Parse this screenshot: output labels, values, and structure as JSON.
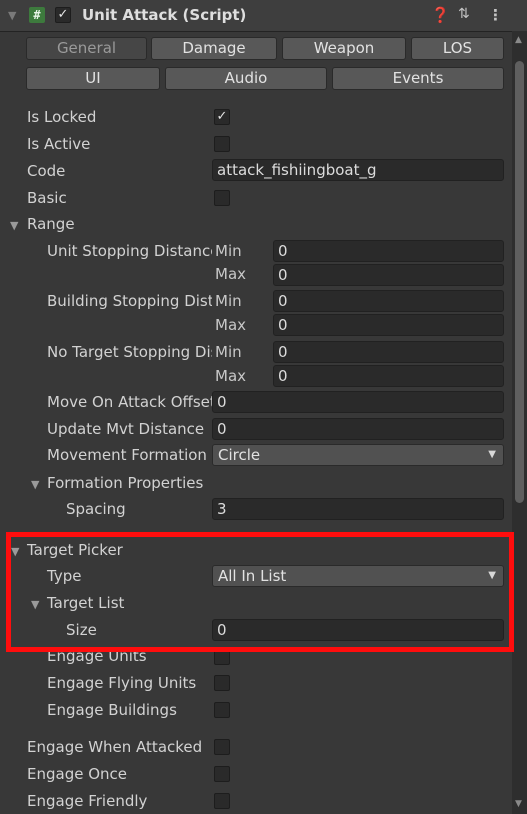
{
  "header": {
    "title": "Unit Attack (Script)",
    "enabled_checked": true,
    "icons": [
      "help-icon",
      "presets-icon",
      "more-icon"
    ]
  },
  "tabs": [
    {
      "label": "General",
      "active": true
    },
    {
      "label": "Damage",
      "active": false
    },
    {
      "label": "Weapon",
      "active": false
    },
    {
      "label": "LOS",
      "active": false
    },
    {
      "label": "UI",
      "active": false
    },
    {
      "label": "Audio",
      "active": false
    },
    {
      "label": "Events",
      "active": false
    }
  ],
  "fields": {
    "is_locked": {
      "label": "Is Locked",
      "checked": true
    },
    "is_active": {
      "label": "Is Active",
      "checked": false
    },
    "code": {
      "label": "Code",
      "value": "attack_fishiingboat_g"
    },
    "basic": {
      "label": "Basic",
      "checked": false
    }
  },
  "range": {
    "label": "Range",
    "unit_stopping": {
      "label": "Unit Stopping Distance",
      "min_label": "Min",
      "min": "0",
      "max_label": "Max",
      "max": "0"
    },
    "building_stopping": {
      "label": "Building Stopping Distance",
      "min_label": "Min",
      "min": "0",
      "max_label": "Max",
      "max": "0"
    },
    "no_target_stopping": {
      "label": "No Target Stopping Distance",
      "min_label": "Min",
      "min": "0",
      "max_label": "Max",
      "max": "0"
    },
    "move_on_attack_offset": {
      "label": "Move On Attack Offset",
      "value": "0"
    },
    "update_mvt_distance": {
      "label": "Update Mvt Distance",
      "value": "0"
    },
    "movement_formation": {
      "label": "Movement Formation",
      "value": "Circle"
    },
    "formation_properties": {
      "label": "Formation Properties",
      "spacing_label": "Spacing",
      "spacing": "3"
    }
  },
  "target_picker": {
    "label": "Target Picker",
    "type_label": "Type",
    "type_value": "All In List",
    "target_list_label": "Target List",
    "size_label": "Size",
    "size_value": "0"
  },
  "engage": {
    "units": {
      "label": "Engage Units",
      "checked": false
    },
    "flying_units": {
      "label": "Engage Flying Units",
      "checked": false
    },
    "buildings": {
      "label": "Engage Buildings",
      "checked": false
    },
    "when_attacked": {
      "label": "Engage When Attacked",
      "checked": false
    },
    "once": {
      "label": "Engage Once",
      "checked": false
    },
    "friendly": {
      "label": "Engage Friendly",
      "checked": false
    }
  },
  "colors": {
    "highlight": "#ff0d0d",
    "background": "#383838",
    "script_icon": "#3d7a3d"
  }
}
